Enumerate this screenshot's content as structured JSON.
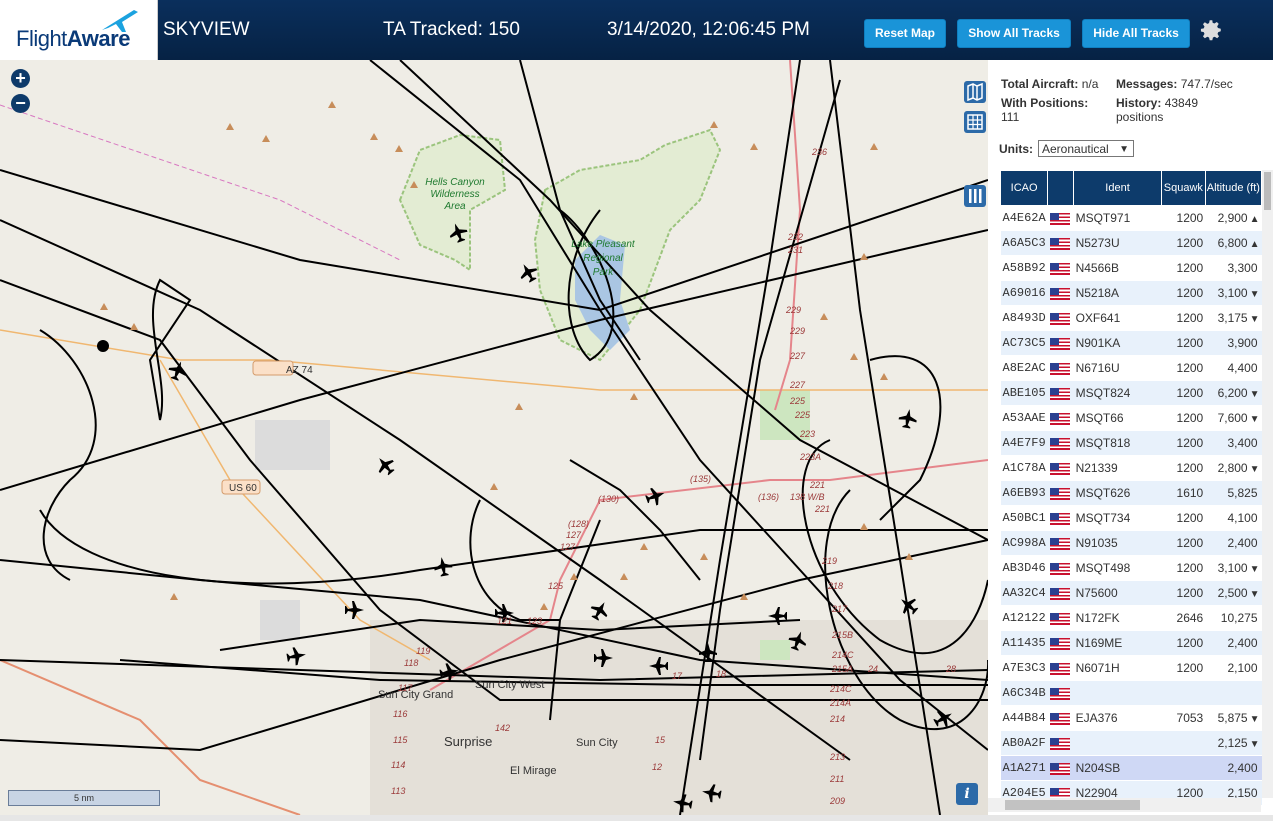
{
  "header": {
    "logo_text_a": "Flight",
    "logo_text_b": "Aware",
    "app_title": "SKYVIEW",
    "tracked": "TA Tracked: 150",
    "datetime": "3/14/2020, 12:06:45 PM",
    "reset_map": "Reset Map",
    "show_all": "Show All Tracks",
    "hide_all": "Hide All Tracks",
    "settings_icon": "gear-icon"
  },
  "map": {
    "zoom_in": "+",
    "zoom_out": "−",
    "scale_label": "5 nm",
    "info_label": "i",
    "labels": {
      "wilderness_1": "Hells Canyon",
      "wilderness_2": "Wilderness",
      "wilderness_3": "Area",
      "lake_1": "Lake Pleasant",
      "lake_2": "Regional",
      "lake_3": "Park",
      "az74": "AZ 74",
      "us60": "US 60",
      "sun_city_grand": "Sun City Grand",
      "sun_city_west": "Sun City West",
      "surprise": "Surprise",
      "sun_city": "Sun City",
      "el_mirage": "El Mirage",
      "r236": "236",
      "r232": "232",
      "r231": "231",
      "r229a": "229",
      "r229b": "229",
      "r227a": "227",
      "r227b": "227",
      "r225a": "225",
      "r225b": "225",
      "r223": "223",
      "r223a": "223A",
      "r221a": "221",
      "r221b": "221",
      "r219": "219",
      "r218": "218",
      "r217": "217",
      "r215b": "215B",
      "r214c": "214C",
      "r215a": "215A",
      "r214c2": "214C",
      "r214a": "214A",
      "r214": "214",
      "r213": "213",
      "r211": "211",
      "r209": "209",
      "r130": "(130)",
      "r128": "(128)",
      "r127a": "127",
      "r127b": "127",
      "r125": "125",
      "r123": "123",
      "r121": "121",
      "r119": "119",
      "r118": "118",
      "r117": "117",
      "r116": "116",
      "r115": "115",
      "r114": "114",
      "r113": "113",
      "r142": "142",
      "r15": "15",
      "r12": "12",
      "r17": "17",
      "r18": "18",
      "r135": "(135)",
      "r136": "(136)",
      "r138": "138 W/B",
      "r24": "24",
      "r28": "28"
    }
  },
  "sidebar": {
    "total_aircraft_label": "Total Aircraft:",
    "total_aircraft_value": "n/a",
    "messages_label": "Messages:",
    "messages_value": "747.7/sec",
    "with_positions_label": "With Positions:",
    "with_positions_value": "111",
    "history_label": "History:",
    "history_value": "43849",
    "history_unit": "positions",
    "units_label": "Units:",
    "units_value": "Aeronautical",
    "columns": [
      "ICAO",
      "",
      "Ident",
      "Squawk",
      "Altitude (ft)"
    ],
    "rows": [
      {
        "icao": "A4E62A",
        "ident": "MSQT971",
        "squawk": "1200",
        "alt": "2,900",
        "trend": "▲"
      },
      {
        "icao": "A6A5C3",
        "ident": "N5273U",
        "squawk": "1200",
        "alt": "6,800",
        "trend": "▲"
      },
      {
        "icao": "A58B92",
        "ident": "N4566B",
        "squawk": "1200",
        "alt": "3,300",
        "trend": ""
      },
      {
        "icao": "A69016",
        "ident": "N5218A",
        "squawk": "1200",
        "alt": "3,100",
        "trend": "▼"
      },
      {
        "icao": "A8493D",
        "ident": "OXF641",
        "squawk": "1200",
        "alt": "3,175",
        "trend": "▼"
      },
      {
        "icao": "AC73C5",
        "ident": "N901KA",
        "squawk": "1200",
        "alt": "3,900",
        "trend": ""
      },
      {
        "icao": "A8E2AC",
        "ident": "N6716U",
        "squawk": "1200",
        "alt": "4,400",
        "trend": ""
      },
      {
        "icao": "ABE105",
        "ident": "MSQT824",
        "squawk": "1200",
        "alt": "6,200",
        "trend": "▼"
      },
      {
        "icao": "A53AAE",
        "ident": "MSQT66",
        "squawk": "1200",
        "alt": "7,600",
        "trend": "▼"
      },
      {
        "icao": "A4E7F9",
        "ident": "MSQT818",
        "squawk": "1200",
        "alt": "3,400",
        "trend": ""
      },
      {
        "icao": "A1C78A",
        "ident": "N21339",
        "squawk": "1200",
        "alt": "2,800",
        "trend": "▼"
      },
      {
        "icao": "A6EB93",
        "ident": "MSQT626",
        "squawk": "1610",
        "alt": "5,825",
        "trend": ""
      },
      {
        "icao": "A50BC1",
        "ident": "MSQT734",
        "squawk": "1200",
        "alt": "4,100",
        "trend": ""
      },
      {
        "icao": "AC998A",
        "ident": "N91035",
        "squawk": "1200",
        "alt": "2,400",
        "trend": ""
      },
      {
        "icao": "AB3D46",
        "ident": "MSQT498",
        "squawk": "1200",
        "alt": "3,100",
        "trend": "▼"
      },
      {
        "icao": "AA32C4",
        "ident": "N75600",
        "squawk": "1200",
        "alt": "2,500",
        "trend": "▼"
      },
      {
        "icao": "A12122",
        "ident": "N172FK",
        "squawk": "2646",
        "alt": "10,275",
        "trend": ""
      },
      {
        "icao": "A11435",
        "ident": "N169ME",
        "squawk": "1200",
        "alt": "2,400",
        "trend": ""
      },
      {
        "icao": "A7E3C3",
        "ident": "N6071H",
        "squawk": "1200",
        "alt": "2,100",
        "trend": ""
      },
      {
        "icao": "A6C34B",
        "ident": "",
        "squawk": "",
        "alt": "",
        "trend": ""
      },
      {
        "icao": "A44B84",
        "ident": "EJA376",
        "squawk": "7053",
        "alt": "5,875",
        "trend": "▼"
      },
      {
        "icao": "AB0A2F",
        "ident": "",
        "squawk": "",
        "alt": "2,125",
        "trend": "▼"
      },
      {
        "icao": "A1A271",
        "ident": "N204SB",
        "squawk": "",
        "alt": "2,400",
        "trend": ""
      },
      {
        "icao": "A204E5",
        "ident": "N22904",
        "squawk": "1200",
        "alt": "2,150",
        "trend": ""
      }
    ],
    "selected_row": 22
  },
  "colors": {
    "header_bg": "#062244",
    "button_bg": "#1a94d8",
    "table_header": "#0d3b6b",
    "track": "#000000"
  }
}
